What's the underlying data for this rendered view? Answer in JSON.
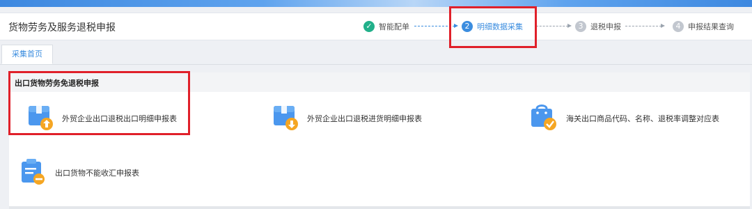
{
  "header": {
    "title": "货物劳务及服务退税申报"
  },
  "steps": [
    {
      "number": "✓",
      "label": "智能配单",
      "state": "done"
    },
    {
      "number": "2",
      "label": "明细数据采集",
      "state": "active"
    },
    {
      "number": "3",
      "label": "退税申报",
      "state": "todo"
    },
    {
      "number": "4",
      "label": "申报结果查询",
      "state": "todo"
    }
  ],
  "tabs": [
    {
      "label": "采集首页"
    }
  ],
  "section": {
    "title": "出口货物劳务免退税申报"
  },
  "cards": [
    {
      "label": "外贸企业出口退税出口明细申报表",
      "icon": "box-upload-icon"
    },
    {
      "label": "外贸企业出口退税进货明细申报表",
      "icon": "box-download-icon"
    },
    {
      "label": "海关出口商品代码、名称、退税率调整对应表",
      "icon": "shopping-bag-check-icon"
    },
    {
      "label": "出口货物不能收汇申报表",
      "icon": "clipboard-minus-icon"
    }
  ],
  "colors": {
    "accent": "#3b8ddf",
    "done": "#21b08a",
    "icon_blue": "#4b97ee",
    "icon_orange": "#f5a623",
    "highlight_red": "#e0202a"
  }
}
